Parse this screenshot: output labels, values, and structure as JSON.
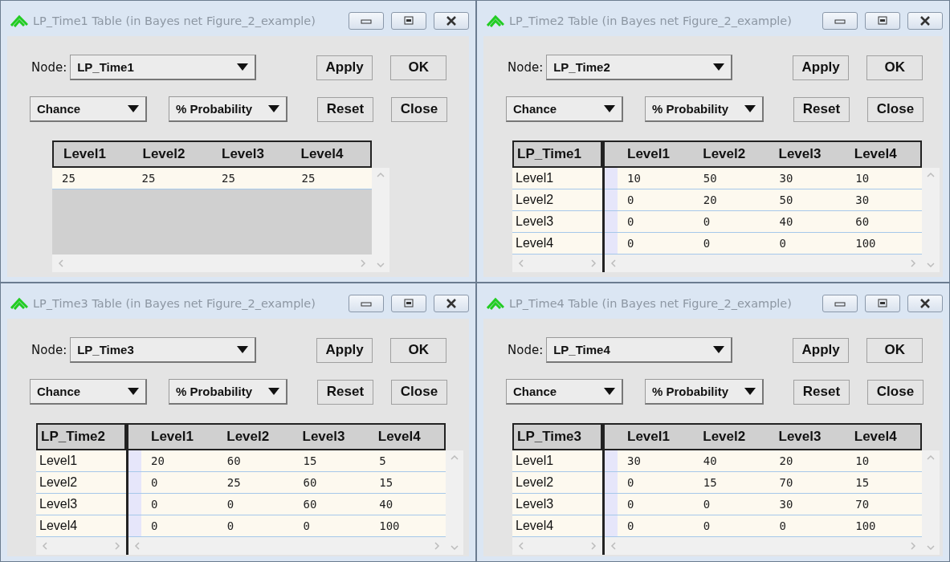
{
  "windows": [
    {
      "title": "LP_Time1 Table (in Bayes net Figure_2_example)",
      "node_label": "Node:",
      "node": "LP_Time1",
      "node_type": "Chance",
      "display_mode": "% Probability",
      "buttons": [
        "Apply",
        "OK",
        "Reset",
        "Close"
      ],
      "table": {
        "columns": [
          "Level1",
          "Level2",
          "Level3",
          "Level4"
        ],
        "rows": [
          {
            "cells": [
              "25",
              "25",
              "25",
              "25"
            ]
          }
        ]
      }
    },
    {
      "title": "LP_Time2 Table (in Bayes net Figure_2_example)",
      "node_label": "Node:",
      "node": "LP_Time2",
      "node_type": "Chance",
      "display_mode": "% Probability",
      "buttons": [
        "Apply",
        "OK",
        "Reset",
        "Close"
      ],
      "table": {
        "parent": "LP_Time1",
        "columns": [
          "Level1",
          "Level2",
          "Level3",
          "Level4"
        ],
        "rows": [
          {
            "label": "Level1",
            "cells": [
              "10",
              "50",
              "30",
              "10"
            ]
          },
          {
            "label": "Level2",
            "cells": [
              "0",
              "20",
              "50",
              "30"
            ]
          },
          {
            "label": "Level3",
            "cells": [
              "0",
              "0",
              "40",
              "60"
            ]
          },
          {
            "label": "Level4",
            "cells": [
              "0",
              "0",
              "0",
              "100"
            ]
          }
        ]
      }
    },
    {
      "title": "LP_Time3 Table (in Bayes net Figure_2_example)",
      "node_label": "Node:",
      "node": "LP_Time3",
      "node_type": "Chance",
      "display_mode": "% Probability",
      "buttons": [
        "Apply",
        "OK",
        "Reset",
        "Close"
      ],
      "table": {
        "parent": "LP_Time2",
        "columns": [
          "Level1",
          "Level2",
          "Level3",
          "Level4"
        ],
        "rows": [
          {
            "label": "Level1",
            "cells": [
              "20",
              "60",
              "15",
              "5"
            ]
          },
          {
            "label": "Level2",
            "cells": [
              "0",
              "25",
              "60",
              "15"
            ]
          },
          {
            "label": "Level3",
            "cells": [
              "0",
              "0",
              "60",
              "40"
            ]
          },
          {
            "label": "Level4",
            "cells": [
              "0",
              "0",
              "0",
              "100"
            ]
          }
        ]
      }
    },
    {
      "title": "LP_Time4 Table (in Bayes net Figure_2_example)",
      "node_label": "Node:",
      "node": "LP_Time4",
      "node_type": "Chance",
      "display_mode": "% Probability",
      "buttons": [
        "Apply",
        "OK",
        "Reset",
        "Close"
      ],
      "table": {
        "parent": "LP_Time3",
        "columns": [
          "Level1",
          "Level2",
          "Level3",
          "Level4"
        ],
        "rows": [
          {
            "label": "Level1",
            "cells": [
              "30",
              "40",
              "20",
              "10"
            ]
          },
          {
            "label": "Level2",
            "cells": [
              "0",
              "15",
              "70",
              "15"
            ]
          },
          {
            "label": "Level3",
            "cells": [
              "0",
              "0",
              "30",
              "70"
            ]
          },
          {
            "label": "Level4",
            "cells": [
              "0",
              "0",
              "0",
              "100"
            ]
          }
        ]
      }
    }
  ]
}
